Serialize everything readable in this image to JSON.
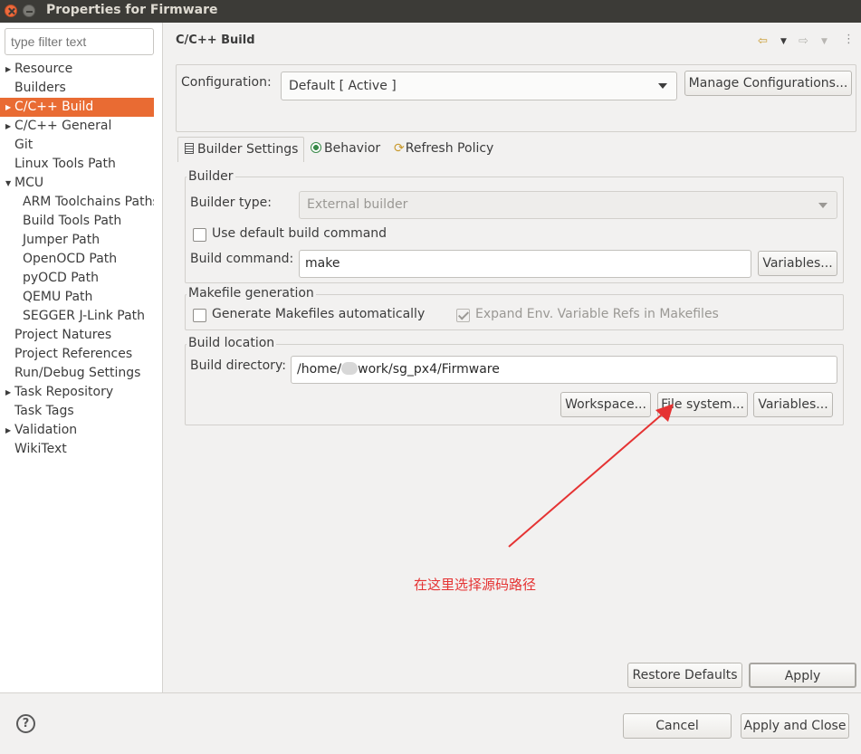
{
  "window": {
    "title": "Properties for Firmware"
  },
  "sidebar": {
    "filter_placeholder": "type filter text",
    "items": [
      {
        "label": "Resource",
        "expandable": true
      },
      {
        "label": "Builders"
      },
      {
        "label": "C/C++ Build",
        "expandable": true,
        "selected": true
      },
      {
        "label": "C/C++ General",
        "expandable": true
      },
      {
        "label": "Git"
      },
      {
        "label": "Linux Tools Path"
      },
      {
        "label": "MCU",
        "expanded": true
      },
      {
        "label": "ARM Toolchains Paths",
        "child": true
      },
      {
        "label": "Build Tools Path",
        "child": true
      },
      {
        "label": "Jumper Path",
        "child": true
      },
      {
        "label": "OpenOCD Path",
        "child": true
      },
      {
        "label": "pyOCD Path",
        "child": true
      },
      {
        "label": "QEMU Path",
        "child": true
      },
      {
        "label": "SEGGER J-Link Path",
        "child": true
      },
      {
        "label": "Project Natures"
      },
      {
        "label": "Project References"
      },
      {
        "label": "Run/Debug Settings"
      },
      {
        "label": "Task Repository",
        "expandable": true
      },
      {
        "label": "Task Tags"
      },
      {
        "label": "Validation",
        "expandable": true
      },
      {
        "label": "WikiText"
      }
    ]
  },
  "page": {
    "title": "C/C++ Build",
    "configuration_label": "Configuration:",
    "configuration_value": "Default  [ Active ]",
    "manage_configurations": "Manage Configurations...",
    "tabs": [
      {
        "label": "Builder Settings",
        "icon": "list-icon",
        "active": true
      },
      {
        "label": "Behavior",
        "icon": "radio-icon"
      },
      {
        "label": "Refresh Policy",
        "icon": "refresh-icon"
      }
    ]
  },
  "builder": {
    "group_label": "Builder",
    "type_label": "Builder type:",
    "type_value": "External builder",
    "use_default_label": "Use default build command",
    "command_label": "Build command:",
    "command_value": "make",
    "variables_label": "Variables..."
  },
  "makefile": {
    "group_label": "Makefile generation",
    "generate_label": "Generate Makefiles automatically",
    "expand_label": "Expand Env. Variable Refs in Makefiles"
  },
  "location": {
    "group_label": "Build location",
    "dir_label": "Build directory:",
    "dir_prefix": "/home/",
    "dir_suffix": "work/sg_px4/Firmware",
    "workspace_label": "Workspace...",
    "filesystem_label": "File system...",
    "variables_label": "Variables..."
  },
  "annotation": {
    "text": "在这里选择源码路径",
    "color": "#e53333"
  },
  "footer": {
    "restore_defaults": "Restore Defaults",
    "apply": "Apply",
    "cancel": "Cancel",
    "apply_and_close": "Apply and Close",
    "help_glyph": "?"
  },
  "colors": {
    "selection": "#e96b33",
    "titlebar": "#3c3b37",
    "annotation": "#e53333"
  }
}
